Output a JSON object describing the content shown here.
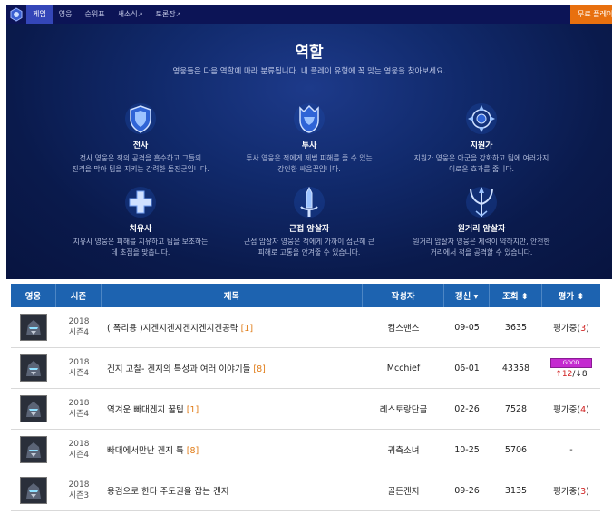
{
  "nav": {
    "items": [
      {
        "label": "게임",
        "active": true,
        "ext": false
      },
      {
        "label": "영웅",
        "active": false,
        "ext": false
      },
      {
        "label": "순위표",
        "active": false,
        "ext": false
      },
      {
        "label": "새소식",
        "active": false,
        "ext": true
      },
      {
        "label": "토론장",
        "active": false,
        "ext": true
      }
    ],
    "ext_mark": "↗",
    "cta": "무료 플레이"
  },
  "hero": {
    "title": "역할",
    "subtitle": "영웅들은 다음 역할에 따라 분류됩니다. 내 플레이 유형에 꼭 맞는 영웅을 찾아보세요.",
    "roles": [
      {
        "name": "전사",
        "desc1": "전사 영웅은 적의 공격을 흡수하고 그들의",
        "desc2": "진격을 막아 팀을 지키는 강력한 돌진군입니다.",
        "icon": "shield-icon"
      },
      {
        "name": "투사",
        "desc1": "투사 영웅은 적에게 제법 피해를 줄 수 있는",
        "desc2": "강인한 싸움꾼입니다.",
        "icon": "helmet-icon"
      },
      {
        "name": "지원가",
        "desc1": "지원가 영웅은 아군을 강화하고 팀에 여러가지",
        "desc2": "이로운 효과를 줍니다.",
        "icon": "compass-icon"
      },
      {
        "name": "치유사",
        "desc1": "치유사 영웅은 피해를 치유하고 팀을 보조하는",
        "desc2": "데 초점을 맞춥니다.",
        "icon": "cross-icon"
      },
      {
        "name": "근접 암살자",
        "desc1": "근접 암살자 영웅은 적에게 가까이 접근해 큰",
        "desc2": "피해로 고통을 안겨줄 수 있습니다.",
        "icon": "sword-icon"
      },
      {
        "name": "원거리 암살자",
        "desc1": "원거리 암살자 영웅은 체력이 약하지만, 안전한",
        "desc2": "거리에서 적을 공격할 수 있습니다.",
        "icon": "trident-icon"
      }
    ]
  },
  "table": {
    "headers": {
      "hero": "영웅",
      "season": "시즌",
      "title": "제목",
      "author": "작성자",
      "date": "갱신 ▾",
      "views": "조회 ⬍",
      "rating": "평가 ⬍"
    },
    "rows": [
      {
        "year": "2018",
        "season": "시즌4",
        "title": "( 폭리용 )지겐지겐지겐지겐지겐공략",
        "count": "[1]",
        "author": "컴스맨스",
        "date": "09-05",
        "views": "3635",
        "rating_pre": "평가중(",
        "rating_num": "3",
        "rating_post": ")"
      },
      {
        "year": "2018",
        "season": "시즌4",
        "title": "겐지 고찰- 겐지의 특성과 여러 이야기들",
        "count": "[8]",
        "author": "Mcchief",
        "date": "06-01",
        "views": "43358",
        "badge": "GOOD",
        "up": "12",
        "down": "8"
      },
      {
        "year": "2018",
        "season": "시즌4",
        "title": "역겨운 빠대겐지 꿀팁",
        "count": "[1]",
        "author": "레스토랑단골",
        "date": "02-26",
        "views": "7528",
        "rating_pre": "평가중(",
        "rating_num": "4",
        "rating_post": ")"
      },
      {
        "year": "2018",
        "season": "시즌4",
        "title": "빠대에서만난 겐지 특",
        "count": "[8]",
        "author": "귀축소녀",
        "date": "10-25",
        "views": "5706",
        "rating_pre": "-",
        "rating_num": "",
        "rating_post": ""
      },
      {
        "year": "2018",
        "season": "시즌3",
        "title": "용검으로 한타 주도권을 잡는 겐지",
        "count": "",
        "author": "골든겐지",
        "date": "09-26",
        "views": "3135",
        "rating_pre": "평가중(",
        "rating_num": "3",
        "rating_post": ")"
      }
    ]
  }
}
